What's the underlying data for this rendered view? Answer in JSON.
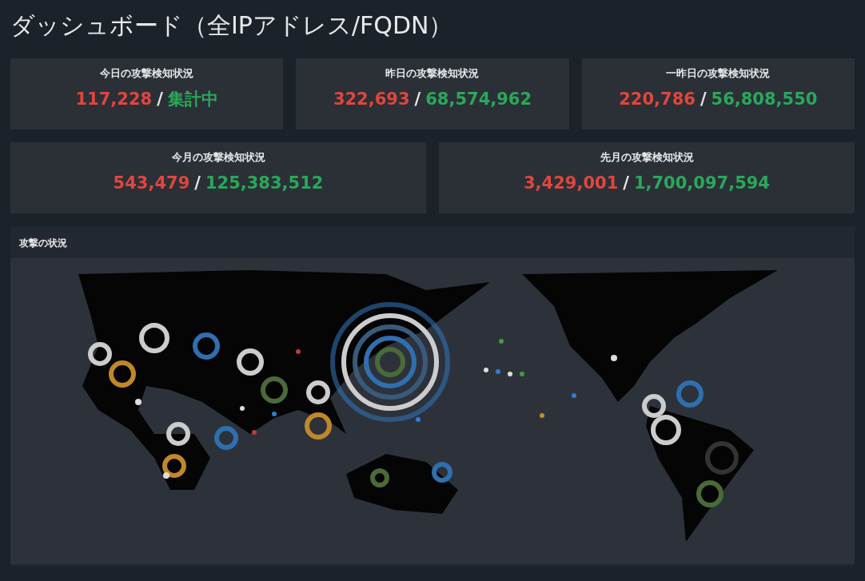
{
  "title": "ダッシュボード（全IPアドレス/FQDN）",
  "stat_rows": [
    [
      {
        "label": "今日の攻撃検知状況",
        "detected": "117,228",
        "separator": "/",
        "total": "集計中"
      },
      {
        "label": "昨日の攻撃検知状況",
        "detected": "322,693",
        "separator": "/",
        "total": "68,574,962"
      },
      {
        "label": "一昨日の攻撃検知状況",
        "detected": "220,786",
        "separator": "/",
        "total": "56,808,550"
      }
    ],
    [
      {
        "label": "今月の攻撃検知状況",
        "detected": "543,479",
        "separator": "/",
        "total": "125,383,512"
      },
      {
        "label": "先月の攻撃検知状況",
        "detected": "3,429,001",
        "separator": "/",
        "total": "1,700,097,594"
      }
    ]
  ],
  "map_panel": {
    "title": "攻撃の状況"
  }
}
